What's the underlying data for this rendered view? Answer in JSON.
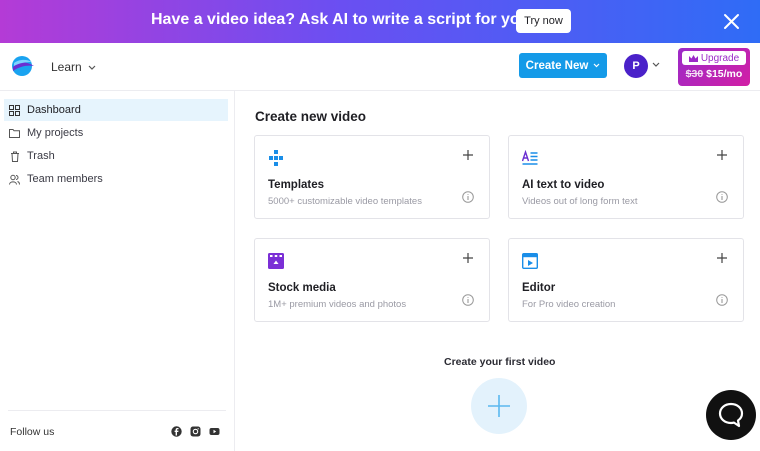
{
  "banner": {
    "text": "Have a video idea? Ask AI to write a script for you.",
    "cta": "Try now"
  },
  "header": {
    "learn_label": "Learn",
    "create_label": "Create New",
    "avatar_initial": "P",
    "upgrade_label": "Upgrade",
    "old_price": "$30",
    "new_price": "$15/mo"
  },
  "sidebar": {
    "items": [
      {
        "label": "Dashboard",
        "icon": "grid-icon"
      },
      {
        "label": "My projects",
        "icon": "folder-icon"
      },
      {
        "label": "Trash",
        "icon": "trash-icon"
      },
      {
        "label": "Team members",
        "icon": "team-icon"
      }
    ],
    "follow_label": "Follow us",
    "social": [
      "facebook-icon",
      "instagram-icon",
      "youtube-icon"
    ]
  },
  "main": {
    "title": "Create new video",
    "cards": [
      {
        "title": "Templates",
        "subtitle": "5000+ customizable video templates",
        "icon": "templates-icon"
      },
      {
        "title": "AI text to video",
        "subtitle": "Videos out of long form text",
        "icon": "ai-text-icon"
      },
      {
        "title": "Stock media",
        "subtitle": "1M+ premium videos and photos",
        "icon": "stock-media-icon"
      },
      {
        "title": "Editor",
        "subtitle": "For Pro video creation",
        "icon": "editor-icon"
      }
    ],
    "first_video_label": "Create your first video"
  },
  "colors": {
    "accent": "#149ae8",
    "avatar": "#4a21c9",
    "upgrade": "#9b2ac8",
    "active_nav_bg": "#e6f4fd"
  }
}
